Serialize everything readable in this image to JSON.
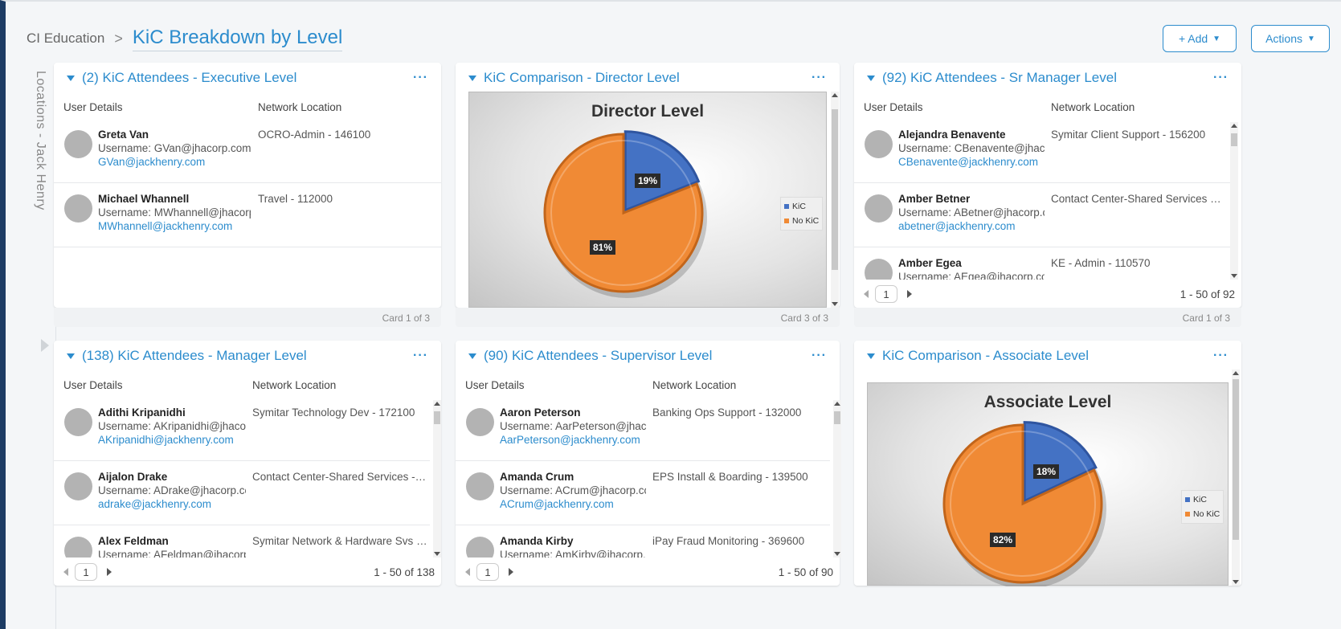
{
  "header": {
    "breadcrumb": "CI Education",
    "title": "KiC Breakdown by Level",
    "add_label": "+ Add",
    "actions_label": "Actions"
  },
  "sidebar": {
    "label": "Locations - Jack Henry"
  },
  "columns": {
    "user": "User Details",
    "location": "Network Location"
  },
  "cards": {
    "executive": {
      "title": "(2) KiC Attendees - Executive Level",
      "footer": "Card 1 of 3",
      "rows": [
        {
          "name": "Greta Van",
          "login": "Username: GVan@jhacorp.com",
          "email": "GVan@jackhenry.com",
          "location": "OCRO-Admin - 146100"
        },
        {
          "name": "Michael Whannell",
          "login": "Username: MWhannell@jhacorp.",
          "email": "MWhannell@jackhenry.com",
          "location": "Travel - 112000"
        }
      ]
    },
    "director": {
      "title": "KiC Comparison - Director Level",
      "footer": "Card 3 of 3",
      "kic_label": "19%",
      "nokic_label": "81%"
    },
    "srmanager": {
      "title": "(92) KiC Attendees - Sr Manager Level",
      "footer": "Card 1 of 3",
      "page": "1",
      "range": "1 - 50 of 92",
      "rows": [
        {
          "name": "Alejandra Benavente",
          "login": "Username: CBenavente@jhacc",
          "email": "CBenavente@jackhenry.com",
          "location": "Symitar Client Support - 156200"
        },
        {
          "name": "Amber Betner",
          "login": "Username: ABetner@jhacorp.c",
          "email": "abetner@jackhenry.com",
          "location": "Contact Center-Shared Services - ..."
        },
        {
          "name": "Amber Egea",
          "login": "Username: AEgea@jhacorp.co",
          "email": "",
          "location": "KE - Admin - 110570"
        }
      ]
    },
    "manager": {
      "title": "(138) KiC Attendees - Manager Level",
      "page": "1",
      "range": "1 - 50 of 138",
      "rows": [
        {
          "name": "Adithi Kripanidhi",
          "login": "Username: AKripanidhi@jhacorp",
          "email": "AKripanidhi@jackhenry.com",
          "location": "Symitar Technology Dev - 172100"
        },
        {
          "name": "Aijalon Drake",
          "login": "Username: ADrake@jhacorp.cc",
          "email": "adrake@jackhenry.com",
          "location": "Contact Center-Shared Services - 3..."
        },
        {
          "name": "Alex Feldman",
          "login": "Username: AFeldman@jhacorp",
          "email": "",
          "location": "Symitar Network & Hardware Svs - 5..."
        }
      ]
    },
    "supervisor": {
      "title": "(90) KiC Attendees - Supervisor Level",
      "page": "1",
      "range": "1 - 50 of 90",
      "rows": [
        {
          "name": "Aaron Peterson",
          "login": "Username: AarPeterson@jhacc",
          "email": "AarPeterson@jackhenry.com",
          "location": "Banking Ops Support - 132000"
        },
        {
          "name": "Amanda Crum",
          "login": "Username: ACrum@jhacorp.co",
          "email": "ACrum@jackhenry.com",
          "location": "EPS Install & Boarding - 139500"
        },
        {
          "name": "Amanda Kirby",
          "login": "Username: AmKirby@jhacorp.c",
          "email": "",
          "location": "iPay Fraud Monitoring - 369600"
        }
      ]
    },
    "associate": {
      "title": "KiC Comparison - Associate Level",
      "kic_label": "18%",
      "nokic_label": "82%"
    }
  },
  "chart_data": [
    {
      "type": "pie",
      "title": "Director Level",
      "categories": [
        "KiC",
        "No KiC"
      ],
      "values": [
        19,
        81
      ],
      "colors": [
        "#4472c4",
        "#f08a35"
      ],
      "legend": "right"
    },
    {
      "type": "pie",
      "title": "Associate Level",
      "categories": [
        "KiC",
        "No KiC"
      ],
      "values": [
        18,
        82
      ],
      "colors": [
        "#4472c4",
        "#f08a35"
      ],
      "legend": "right"
    }
  ]
}
